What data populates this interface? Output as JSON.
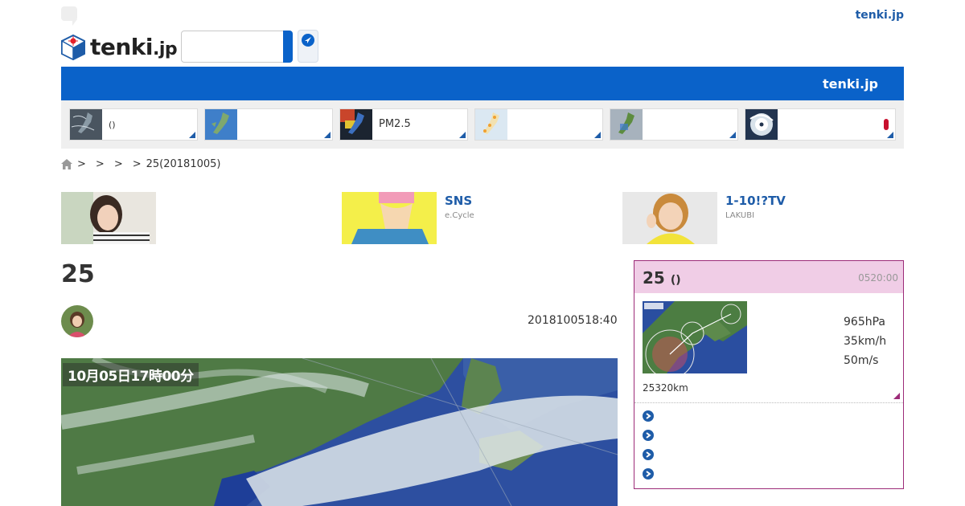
{
  "header": {
    "site_link": "tenki.jp",
    "logo_text": "tenki",
    "logo_suffix": ".jp",
    "search_placeholder": ""
  },
  "blue_bar": {
    "title": "tenki.jp"
  },
  "map_tiles": [
    {
      "label": "()",
      "thumb": "weather-map"
    },
    {
      "label": "",
      "thumb": "radar-map"
    },
    {
      "label": "PM2.5",
      "thumb": "pm25-map"
    },
    {
      "label": "",
      "thumb": "forecast-map"
    },
    {
      "label": "",
      "thumb": "rain-map"
    },
    {
      "label": "",
      "thumb": "typhoon-map",
      "alert": true
    }
  ],
  "breadcrumb": {
    "separators": [
      ">",
      ">",
      ">",
      ">"
    ],
    "current": "25(20181005)"
  },
  "ads": [
    {
      "title": "",
      "source": ""
    },
    {
      "title": "SNS",
      "source": "e.Cycle"
    },
    {
      "title": "1-10!?TV",
      "source": "LAKUBI"
    }
  ],
  "article": {
    "title": "25",
    "date": "2018100518:40",
    "image_stamp": "10月05日17時00分"
  },
  "typhoon_panel": {
    "title": "25",
    "title_suffix": "()",
    "time": "0520:00",
    "pressure": "965hPa",
    "speed": "35km/h",
    "max_wind": "50m/s",
    "distance": "25320km",
    "link_count": 4
  },
  "colors": {
    "brand_blue": "#0a62c9",
    "link_blue": "#1e5ca8",
    "typhoon_border": "#9c2b78",
    "typhoon_header": "#f0cde6"
  }
}
